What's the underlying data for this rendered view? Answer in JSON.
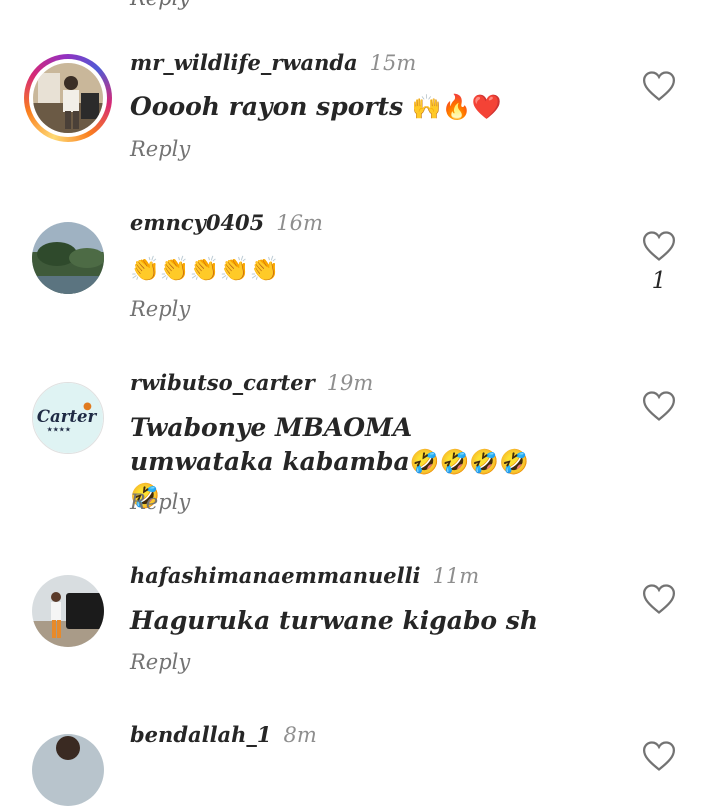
{
  "top_partial": {
    "reply_label": "Reply"
  },
  "comments": [
    {
      "username": "mr_wildlife_rwanda",
      "time": "15m",
      "text": "Ooooh rayon sports ",
      "emojis": "🙌🔥❤️",
      "reply_label": "Reply",
      "like_count": "",
      "has_story_ring": true
    },
    {
      "username": "emncy0405",
      "time": "16m",
      "text": "",
      "emojis": "👏👏👏👏👏",
      "reply_label": "Reply",
      "like_count": "1"
    },
    {
      "username": "rwibutso_carter",
      "time": "19m",
      "text": "Twabonye MBAOMA umwataka kabamba",
      "emojis": "🤣🤣🤣🤣🤣",
      "reply_label": "Reply",
      "like_count": "",
      "avatar_text": "Carter"
    },
    {
      "username": "hafashimanaemmanuelli",
      "time": "11m",
      "text": "Haguruka turwane kigabo sh",
      "emojis": "",
      "reply_label": "Reply",
      "like_count": ""
    },
    {
      "username": "bendallah_1",
      "time": "8m"
    }
  ],
  "icons": {
    "like": "heart-outline-icon"
  },
  "colors": {
    "text": "#262626",
    "muted": "#8e8e8e",
    "story_ring": "#d62976"
  }
}
